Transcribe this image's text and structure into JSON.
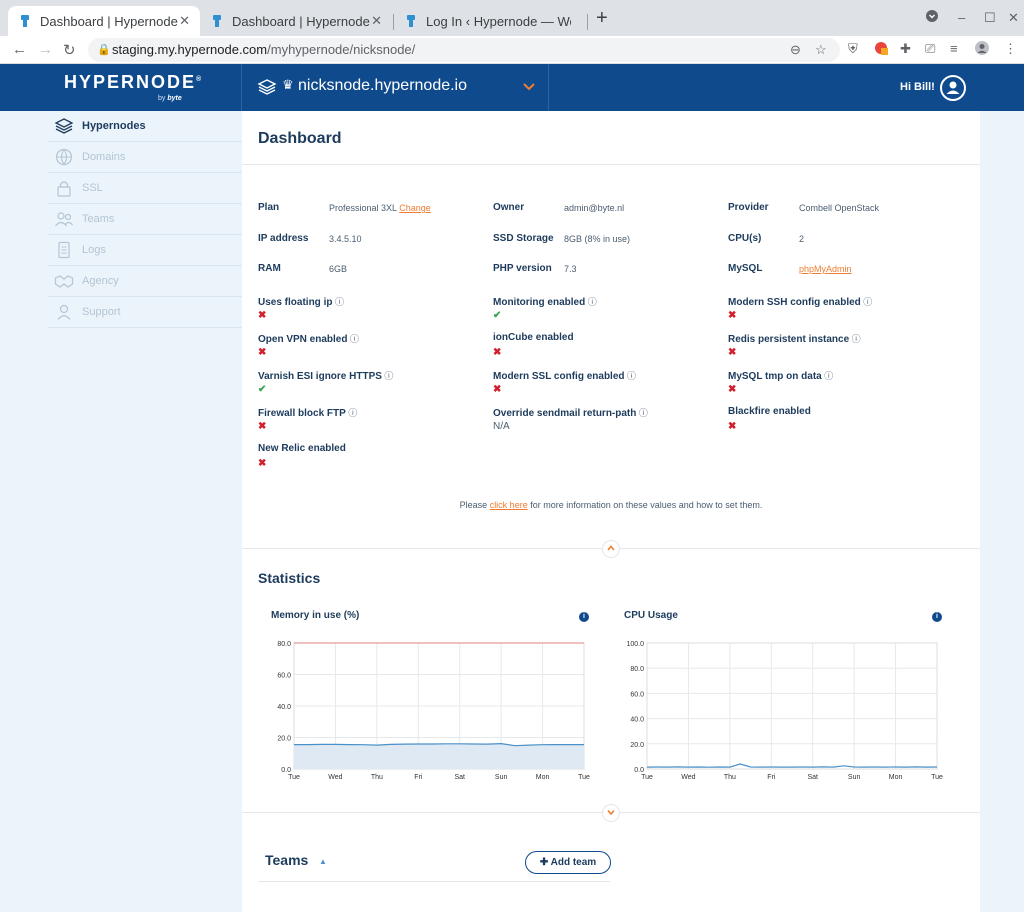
{
  "browser": {
    "tabs": [
      {
        "title": "Dashboard | Hypernode",
        "active": true
      },
      {
        "title": "Dashboard | Hypernode",
        "active": false
      },
      {
        "title": "Log In ‹ Hypernode — Wo",
        "active": false
      }
    ],
    "url_host": "staging.my.hypernode.com",
    "url_path": "/myhypernode/nicksnode/"
  },
  "header": {
    "logo": "HYPERNODE",
    "logo_mark": "®",
    "logo_sub_by": "by",
    "logo_sub_brand": "byte",
    "node_name": "nicksnode.hypernode.io",
    "greeting": "Hi Bill!"
  },
  "sidebar": {
    "items": [
      {
        "label": "Hypernodes",
        "icon": "layers-icon",
        "active": true
      },
      {
        "label": "Domains",
        "icon": "globe-icon",
        "active": false
      },
      {
        "label": "SSL",
        "icon": "lock-icon",
        "active": false
      },
      {
        "label": "Teams",
        "icon": "people-icon",
        "active": false
      },
      {
        "label": "Logs",
        "icon": "document-icon",
        "active": false
      },
      {
        "label": "Agency",
        "icon": "handshake-icon",
        "active": false
      },
      {
        "label": "Support",
        "icon": "support-icon",
        "active": false
      }
    ]
  },
  "dashboard": {
    "title": "Dashboard",
    "info": {
      "plan_label": "Plan",
      "plan_value": "Professional 3XL",
      "plan_change": "Change",
      "ip_label": "IP address",
      "ip_value": "3.4.5.10",
      "ram_label": "RAM",
      "ram_value": "6GB",
      "owner_label": "Owner",
      "owner_value": "admin@byte.nl",
      "ssd_label": "SSD Storage",
      "ssd_value": "8GB (8% in use)",
      "php_label": "PHP version",
      "php_value": "7.3",
      "provider_label": "Provider",
      "provider_value": "Combell OpenStack",
      "cpu_label": "CPU(s)",
      "cpu_value": "2",
      "mysql_label": "MySQL",
      "mysql_value": "phpMyAdmin"
    },
    "flags": [
      {
        "label": "Uses floating ip",
        "info": true,
        "value": "✖",
        "state": "no"
      },
      {
        "label": "Monitoring enabled",
        "info": true,
        "value": "✔",
        "state": "yes"
      },
      {
        "label": "Modern SSH config enabled",
        "info": true,
        "value": "✖",
        "state": "no"
      },
      {
        "label": "Open VPN enabled",
        "info": true,
        "value": "✖",
        "state": "no"
      },
      {
        "label": "ionCube enabled",
        "info": false,
        "value": "✖",
        "state": "no"
      },
      {
        "label": "Redis persistent instance",
        "info": true,
        "value": "✖",
        "state": "no"
      },
      {
        "label": "Varnish ESI ignore HTTPS",
        "info": true,
        "value": "✔",
        "state": "yes"
      },
      {
        "label": "Modern SSL config enabled",
        "info": true,
        "value": "✖",
        "state": "no"
      },
      {
        "label": "MySQL tmp on data",
        "info": true,
        "value": "✖",
        "state": "no"
      },
      {
        "label": "Firewall block FTP",
        "info": true,
        "value": "✖",
        "state": "no"
      },
      {
        "label": "Override sendmail return-path",
        "info": true,
        "value": "N/A",
        "state": "na"
      },
      {
        "label": "Blackfire enabled",
        "info": false,
        "value": "✖",
        "state": "no"
      },
      {
        "label": "New Relic enabled",
        "info": false,
        "value": "✖",
        "state": "no"
      }
    ],
    "info_symbol": "ⓘ",
    "note_before": "Please ",
    "note_link": "click here",
    "note_after": " for more information on these values and how to set them."
  },
  "statistics": {
    "title": "Statistics"
  },
  "teams": {
    "title": "Teams",
    "add_label": "Add team"
  },
  "colors": {
    "brand_blue": "#0f4b8c",
    "accent_orange": "#ee7d31",
    "no_red": "#d3202f",
    "yes_green": "#3aa655",
    "side_bg": "#ebf4fb"
  },
  "chart_data": [
    {
      "type": "area",
      "title": "Memory in use (%)",
      "categories": [
        "Tue",
        "Wed",
        "Thu",
        "Fri",
        "Sat",
        "Sun",
        "Mon",
        "Tue"
      ],
      "yticks": [
        "0.0",
        "20.0",
        "40.0",
        "60.0",
        "80.0"
      ],
      "ylim": [
        0,
        80
      ],
      "threshold": 80,
      "series": [
        {
          "values": [
            15.5,
            15.5,
            15.6,
            15.6,
            15.5,
            15.4,
            15.2,
            15.6,
            15.8,
            15.9,
            15.9,
            16.0,
            16.0,
            15.9,
            15.8,
            16.1,
            14.8,
            15.2,
            15.4,
            15.5,
            15.5,
            15.5
          ]
        }
      ]
    },
    {
      "type": "line",
      "title": "CPU Usage",
      "categories": [
        "Tue",
        "Wed",
        "Thu",
        "Fri",
        "Sat",
        "Sun",
        "Mon",
        "Tue"
      ],
      "yticks": [
        "0.0",
        "20.0",
        "40.0",
        "60.0",
        "80.0",
        "100.0"
      ],
      "ylim": [
        0,
        100
      ],
      "series": [
        {
          "values": [
            1.5,
            1.6,
            1.5,
            1.7,
            1.5,
            1.6,
            1.4,
            1.6,
            1.5,
            4.0,
            1.6,
            1.5,
            1.6,
            1.5,
            1.5,
            1.6,
            1.5,
            1.7,
            1.5,
            2.5,
            1.6,
            1.5,
            1.6,
            1.5,
            1.6,
            1.5,
            1.7,
            1.5,
            1.6
          ]
        }
      ]
    }
  ]
}
